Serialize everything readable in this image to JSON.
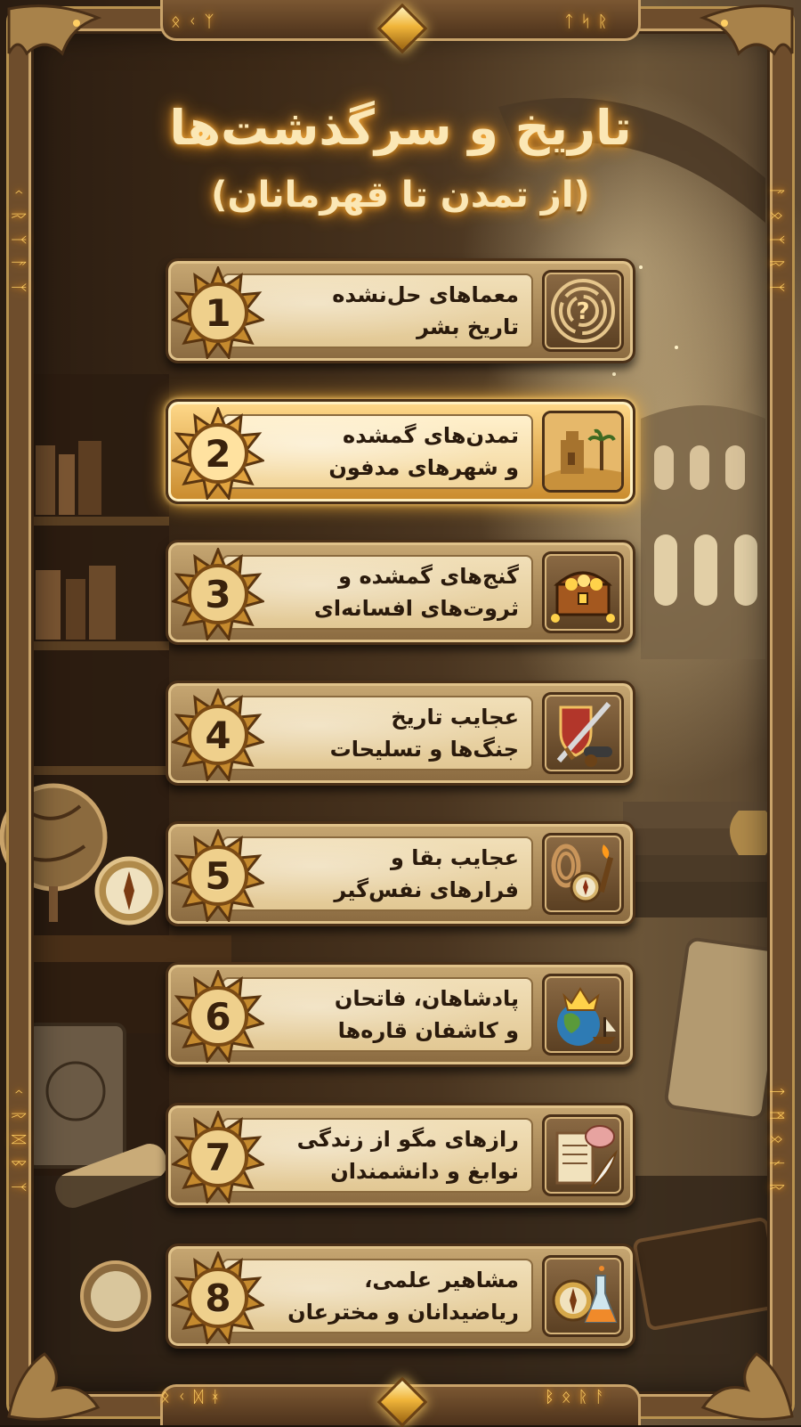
{
  "title": "تاریخ و سرگذشت‌ها",
  "subtitle": "(از تمدن تا قهرمانان)",
  "menu_items": [
    {
      "number": "1",
      "line1": "معماهای حل‌نشده",
      "line2": "تاریخ بشر",
      "icon": "maze-question-icon"
    },
    {
      "number": "2",
      "line1": "تمدن‌های گمشده",
      "line2": "و شهرهای مدفون",
      "icon": "desert-ruins-icon"
    },
    {
      "number": "3",
      "line1": "گنج‌های گمشده و",
      "line2": "ثروت‌های افسانه‌ای",
      "icon": "treasure-chest-icon"
    },
    {
      "number": "4",
      "line1": "عجایب تاریخ",
      "line2": "جنگ‌ها و تسلیحات",
      "icon": "shield-sword-cannon-icon"
    },
    {
      "number": "5",
      "line1": "عجایب بقا و",
      "line2": "فرارهای نفس‌گیر",
      "icon": "rope-compass-torch-icon"
    },
    {
      "number": "6",
      "line1": "پادشاهان، فاتحان",
      "line2": "و کاشفان قاره‌ها",
      "icon": "crown-globe-ship-icon"
    },
    {
      "number": "7",
      "line1": "رازهای مگو از زندگی",
      "line2": "نوابغ و دانشمندان",
      "icon": "scroll-brain-quill-icon"
    },
    {
      "number": "8",
      "line1": "مشاهیر علمی،",
      "line2": "ریاضیدانان و مخترعان",
      "icon": "compass-flask-icon"
    }
  ],
  "selected_index": 1,
  "runes": {
    "top_left": "ᛟᚲᛉ",
    "top_right": "ᛏᛋᚱ",
    "bottom_left": "ᛟᚲᛞᚼ",
    "bottom_right": "ᛒᛟᚱᚨ",
    "left_upper": "ᚲᚱᛉᚨᛉ",
    "right_upper": "ᚨᛟᛉᚱᛉ",
    "left_lower": "ᚲᚱᛞᛒᛉ",
    "right_lower": "ᛏᛗᛟᚾᚱ"
  },
  "colors": {
    "title_glow": "#ff9a1a",
    "title_text": "#fbe7b5",
    "highlight": "#ffb83d",
    "frame": "#6e4d2c",
    "gold": "#c9a36a"
  }
}
